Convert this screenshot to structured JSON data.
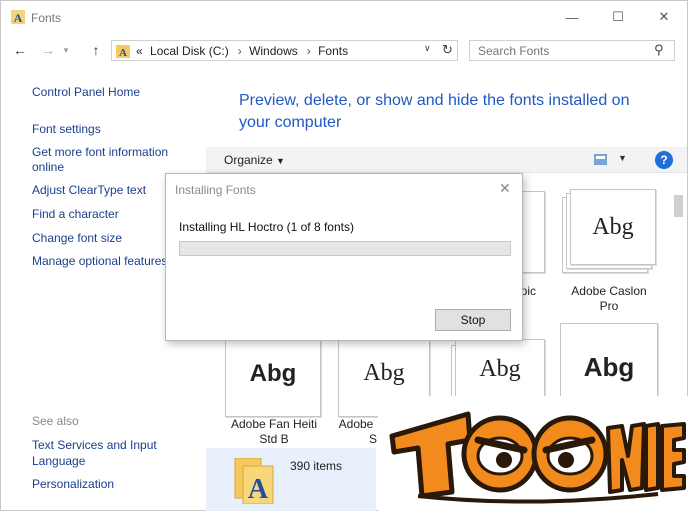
{
  "window": {
    "title": "Fonts"
  },
  "nav": {
    "crumbs": [
      "«",
      "Local Disk (C:)",
      "Windows",
      "Fonts"
    ],
    "search_placeholder": "Search Fonts"
  },
  "sidebar": {
    "control_panel_home": "Control Panel Home",
    "links": [
      "Font settings",
      "Get more font information",
      "online",
      "Adjust ClearType text",
      "Find a character",
      "Change font size",
      "Manage optional features"
    ],
    "see_also_label": "See also",
    "see_also": [
      "Text Services and Input",
      "Language",
      "Personalization"
    ]
  },
  "main": {
    "heading_line1": "Preview, delete, or show and hide the fonts installed on",
    "heading_line2": "your computer",
    "organize": "Organize",
    "help": "?",
    "tiles": [
      {
        "sample": "Abg",
        "label": "Adobe Caslon",
        "label2": "Pro"
      },
      {
        "sample": "Abg",
        "label": "Adobe Fan Heiti",
        "label2": "Std B"
      },
      {
        "sample": "Abg",
        "label": "Adobe",
        "label2": "S"
      },
      {
        "sample": "Abg",
        "label": "",
        "label2": ""
      },
      {
        "sample": "Abg",
        "label": "",
        "label2": ""
      }
    ],
    "partial_label": "pic"
  },
  "dialog": {
    "title": "Installing Fonts",
    "message": "Installing HL Hoctro (1 of 8 fonts)",
    "progress": 0,
    "stop_label": "Stop"
  },
  "status": {
    "count": "390 items"
  },
  "logo": {
    "text": "TOONIES"
  },
  "colors": {
    "link": "#1a3f8f",
    "heading": "#1f58c4",
    "help": "#1e6fd9",
    "logo_orange": "#f28a1e"
  }
}
